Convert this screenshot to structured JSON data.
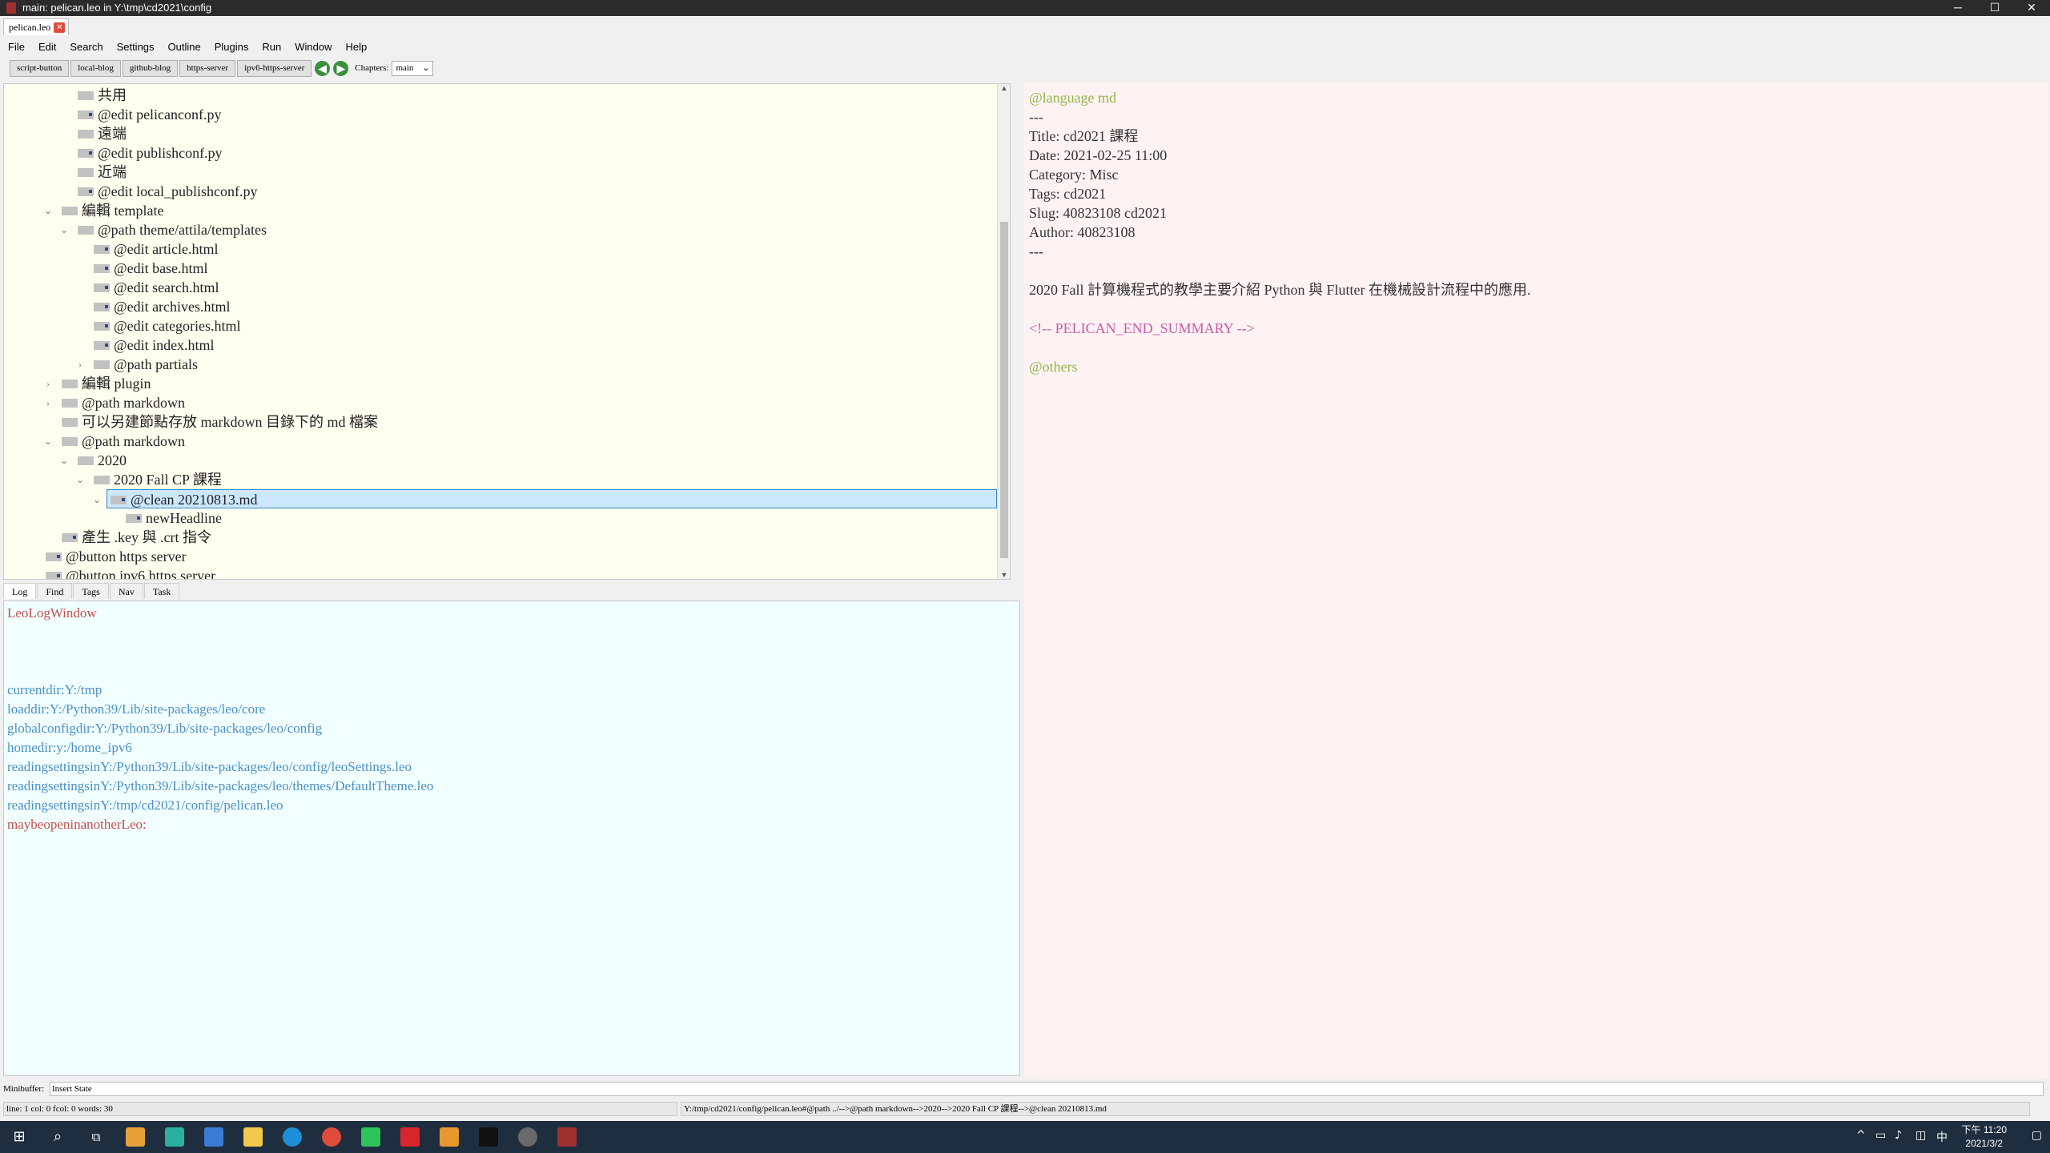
{
  "window": {
    "title": "main: pelican.leo in Y:\\tmp\\cd2021\\config",
    "minimize": "─",
    "maximize": "☐",
    "close": "✕"
  },
  "tab": {
    "label": "pelican.leo",
    "close": "✕"
  },
  "menu": [
    "File",
    "Edit",
    "Search",
    "Settings",
    "Outline",
    "Plugins",
    "Run",
    "Window",
    "Help"
  ],
  "toolbar": {
    "buttons": [
      "script-button",
      "local-blog",
      "github-blog",
      "https-server",
      "ipv6-https-server"
    ],
    "chapters_label": "Chapters:",
    "chapters_value": "main",
    "back_glyph": "◀",
    "forward_glyph": "▶"
  },
  "outline": {
    "nodes": [
      {
        "text": "共用",
        "arrow": ""
      },
      {
        "text": "@edit pelicanconf.py",
        "arrow": ""
      },
      {
        "text": "遠端",
        "arrow": ""
      },
      {
        "text": "@edit publishconf.py",
        "arrow": ""
      },
      {
        "text": "近端",
        "arrow": ""
      },
      {
        "text": "@edit local_publishconf.py",
        "arrow": ""
      },
      {
        "text": "編輯 template",
        "arrow": "⌄"
      },
      {
        "text": "@path theme/attila/templates",
        "arrow": "⌄"
      },
      {
        "text": "@edit article.html",
        "arrow": ""
      },
      {
        "text": "@edit base.html",
        "arrow": ""
      },
      {
        "text": "@edit search.html",
        "arrow": ""
      },
      {
        "text": "@edit archives.html",
        "arrow": ""
      },
      {
        "text": "@edit categories.html",
        "arrow": ""
      },
      {
        "text": "@edit index.html",
        "arrow": ""
      },
      {
        "text": "@path partials",
        "arrow": "›"
      },
      {
        "text": "編輯 plugin",
        "arrow": "›"
      },
      {
        "text": "@path markdown",
        "arrow": "›"
      },
      {
        "text": "可以另建節點存放 markdown 目錄下的 md 檔案",
        "arrow": ""
      },
      {
        "text": "@path markdown",
        "arrow": "⌄"
      },
      {
        "text": "2020",
        "arrow": "⌄"
      },
      {
        "text": "2020 Fall CP 課程",
        "arrow": "⌄"
      },
      {
        "text": "@clean 20210813.md",
        "arrow": "⌄"
      },
      {
        "text": "newHeadline",
        "arrow": ""
      },
      {
        "text": "產生 .key 與 .crt 指令",
        "arrow": ""
      },
      {
        "text": "@button https server",
        "arrow": ""
      },
      {
        "text": "@button ipv6 https server",
        "arrow": ""
      }
    ]
  },
  "body_lines": [
    "@language md",
    "---",
    "Title: cd2021 課程",
    "Date: 2021-02-25 11:00",
    "Category: Misc",
    "Tags: cd2021",
    "Slug: 40823108 cd2021",
    "Author: 40823108",
    "---",
    "",
    "2020 Fall 計算機程式的教學主要介紹 Python 與 Flutter 在機械設計流程中的應用.",
    "",
    "<!-- PELICAN_END_SUMMARY -->",
    "",
    "@others"
  ],
  "log_tabs": [
    "Log",
    "Find",
    "Tags",
    "Nav",
    "Task"
  ],
  "log_lines": [
    "LeoLogWindow",
    "",
    "",
    "",
    "currentdir:Y:/tmp",
    "loaddir:Y:/Python39/Lib/site-packages/leo/core",
    "globalconfigdir:Y:/Python39/Lib/site-packages/leo/config",
    "homedir:y:/home_ipv6",
    "readingsettingsinY:/Python39/Lib/site-packages/leo/config/leoSettings.leo",
    "readingsettingsinY:/Python39/Lib/site-packages/leo/themes/DefaultTheme.leo",
    "readingsettingsinY:/tmp/cd2021/config/pelican.leo",
    "maybeopeninanotherLeo:"
  ],
  "minibuffer": {
    "label": "Minibuffer:",
    "value": "Insert State"
  },
  "status": {
    "left": "line: 1 col: 0  fcol: 0 words: 30",
    "right": "Y:/tmp/cd2021/config/pelican.leo#@path ../-->@path markdown-->2020-->2020 Fall CP 課程-->@clean 20210813.md"
  },
  "taskbar": {
    "time": "下午 11:20",
    "date": "2021/3/2",
    "ime": "中"
  },
  "colors": {
    "outline_bg": "#fffff0",
    "body_bg": "#fff2f2",
    "log_bg": "#f2ffff",
    "directive_green": "#8fb84a",
    "comment_magenta": "#c85ca8",
    "log_red": "#c0504d",
    "log_blue": "#4a90c8",
    "selection": "#cce8ff"
  }
}
